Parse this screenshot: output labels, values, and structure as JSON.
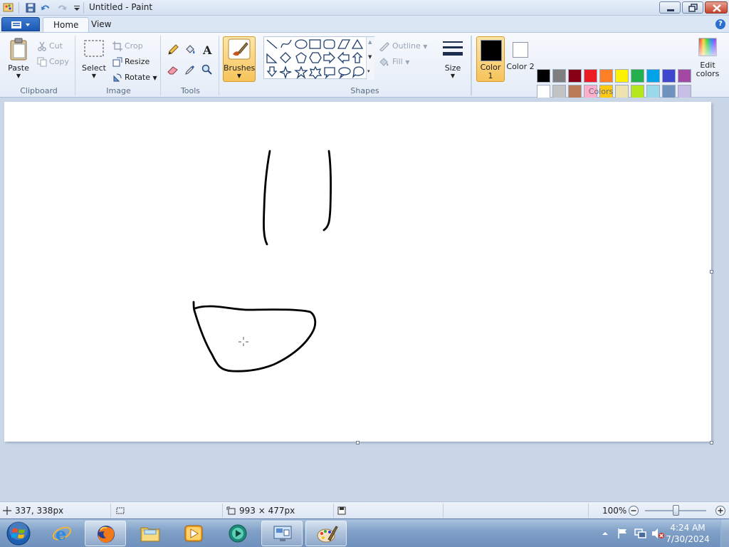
{
  "window": {
    "title": "Untitled - Paint"
  },
  "tabs": [
    {
      "label": "Home",
      "active": true
    },
    {
      "label": "View",
      "active": false
    }
  ],
  "clipboard": {
    "paste": "Paste",
    "cut": "Cut",
    "copy": "Copy",
    "group_label": "Clipboard"
  },
  "image": {
    "select": "Select",
    "crop": "Crop",
    "resize": "Resize",
    "rotate": "Rotate",
    "group_label": "Image"
  },
  "tools": {
    "group_label": "Tools",
    "items": [
      "pencil-icon",
      "fill-bucket-icon",
      "text-icon",
      "eraser-icon",
      "color-picker-icon",
      "magnifier-icon"
    ]
  },
  "brushes": {
    "label": "Brushes"
  },
  "shapes": {
    "outline": "Outline",
    "fill": "Fill",
    "group_label": "Shapes"
  },
  "size": {
    "label": "Size"
  },
  "colors": {
    "color1_label": "Color 1",
    "color2_label": "Color 2",
    "color1": "#000000",
    "color2": "#ffffff",
    "edit_label": "Edit colors",
    "group_label": "Colors",
    "row1": [
      "#000000",
      "#7f7f7f",
      "#880015",
      "#ed1c24",
      "#ff7f27",
      "#fff200",
      "#22b14c",
      "#00a2e8",
      "#3f48cc",
      "#a349a4"
    ],
    "row2": [
      "#ffffff",
      "#c3c3c3",
      "#b97a57",
      "#ffaec9",
      "#ffc90e",
      "#efe4b0",
      "#b5e61d",
      "#99d9ea",
      "#7092be",
      "#c8bfe7"
    ]
  },
  "status": {
    "cursor_pos": "337, 338px",
    "canvas_size": "993 × 477px",
    "zoom": "100%"
  },
  "taskbar": {
    "time": "4:24 AM",
    "date": "7/30/2024"
  }
}
